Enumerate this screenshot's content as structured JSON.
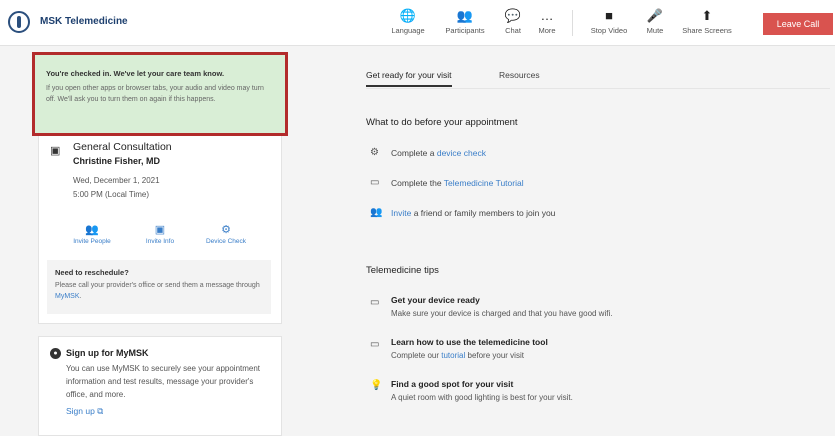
{
  "topbar": {
    "brand": "MSK Telemedicine",
    "tools": [
      {
        "label": "Language",
        "icon": "globe-icon",
        "glyph": "🌐"
      },
      {
        "label": "Participants",
        "icon": "participants-icon",
        "glyph": "👥"
      },
      {
        "label": "Chat",
        "icon": "chat-icon",
        "glyph": "💬"
      },
      {
        "label": "More",
        "icon": "more-icon",
        "glyph": "…"
      },
      {
        "label": "Stop Video",
        "icon": "video-camera-icon",
        "glyph": "■"
      },
      {
        "label": "Mute",
        "icon": "microphone-icon",
        "glyph": "🎤"
      },
      {
        "label": "Share Screens",
        "icon": "share-screen-icon",
        "glyph": "⬆"
      }
    ],
    "leave_label": "Leave Call",
    "leave_color": "#d9534f"
  },
  "checked_in": {
    "title": "You're checked in. We've let your care team know.",
    "body": "If you open other apps or browser tabs, your audio and video may turn off. We'll ask you to turn them on again if this happens."
  },
  "appointment": {
    "type": "General Consultation",
    "doctor": "Christine Fisher, MD",
    "date": "Wed, December 1, 2021",
    "time": "5:00 PM (Local Time)",
    "actions": [
      {
        "label": "Invite People",
        "icon": "invite-people-icon",
        "glyph": "👥"
      },
      {
        "label": "Invite Info",
        "icon": "calendar-icon",
        "glyph": "▣"
      },
      {
        "label": "Device Check",
        "icon": "gear-icon",
        "glyph": "⚙"
      }
    ]
  },
  "reschedule": {
    "title": "Need to reschedule?",
    "body": "Please call your provider's office or send them a message through ",
    "link": "MyMSK",
    "end": "."
  },
  "signup": {
    "title": "Sign up for MyMSK",
    "body": "You can use MyMSK to securely see your appointment information and test results, message your provider's office, and more.",
    "link": "Sign up ⧉"
  },
  "tabs": [
    {
      "label": "Get ready for your visit",
      "active": true
    },
    {
      "label": "Resources",
      "active": false
    }
  ],
  "before": {
    "title": "What to do before your appointment",
    "items": [
      {
        "prefix": "Complete a ",
        "link": "device check",
        "suffix": "",
        "glyph": "⚙"
      },
      {
        "prefix": "Complete the ",
        "link": "Telemedicine Tutorial",
        "suffix": "",
        "glyph": "▭"
      },
      {
        "prefix": "",
        "link": "Invite",
        "suffix": " a friend or family members to join you",
        "glyph": "👥"
      }
    ]
  },
  "tips": {
    "title": "Telemedicine tips",
    "items": [
      {
        "title": "Get your device ready",
        "desc_prefix": "Make sure your device is charged and that you have good wifi.",
        "desc_link": "",
        "desc_suffix": "",
        "glyph": "▭"
      },
      {
        "title": "Learn how to use the telemedicine tool",
        "desc_prefix": "Complete our ",
        "desc_link": "tutorial",
        "desc_suffix": " before your visit",
        "glyph": "▭"
      },
      {
        "title": "Find a good spot for your visit",
        "desc_prefix": "A quiet room with good lighting is best for your visit.",
        "desc_link": "",
        "desc_suffix": "",
        "glyph": "💡"
      }
    ]
  }
}
